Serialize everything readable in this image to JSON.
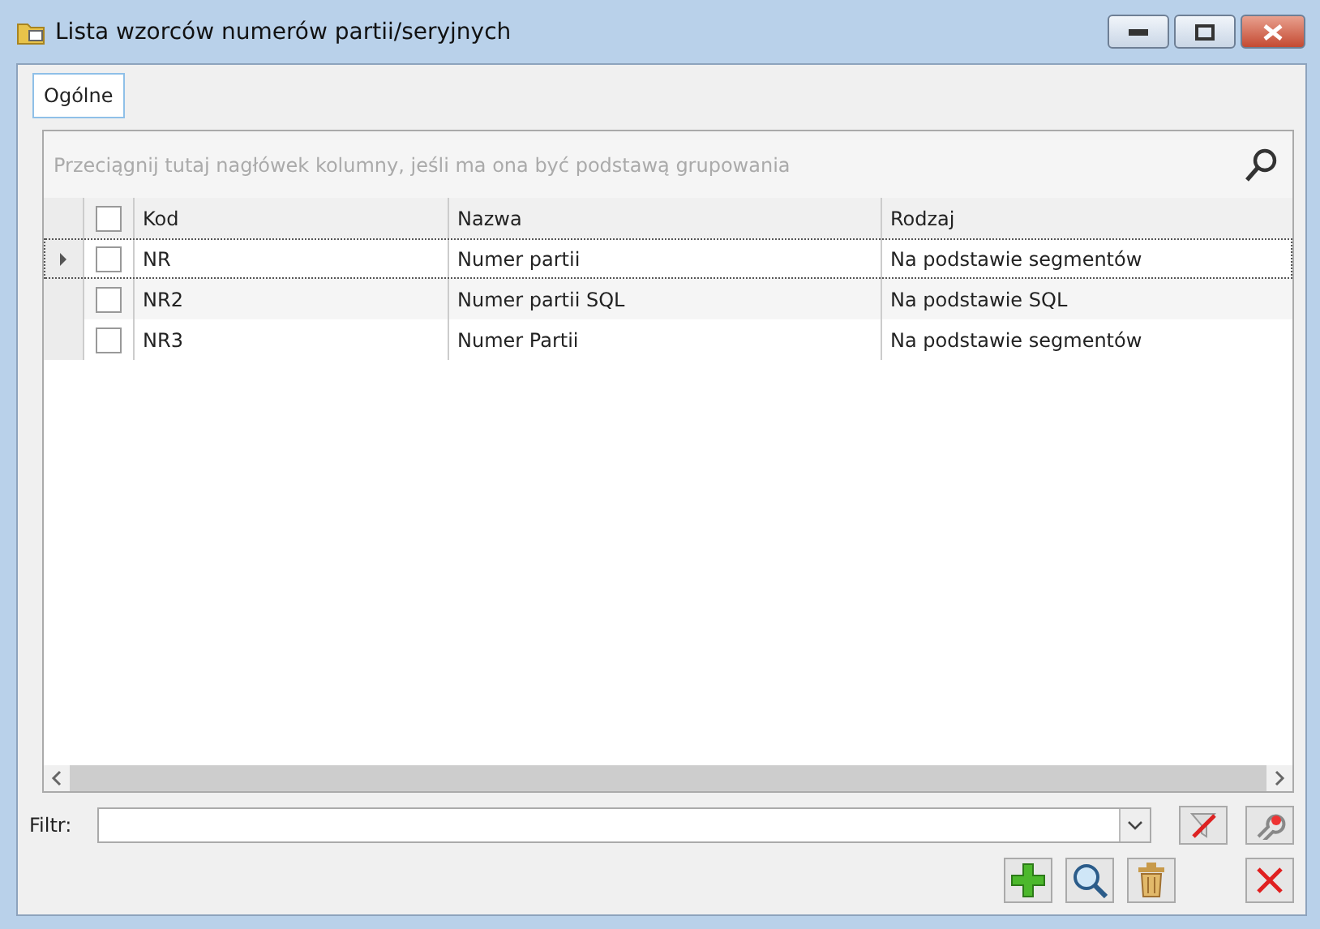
{
  "window": {
    "title": "Lista wzorców numerów partii/seryjnych"
  },
  "tabs": [
    {
      "label": "Ogólne",
      "selected": true
    }
  ],
  "group_panel": {
    "placeholder": "Przeciągnij tutaj nagłówek kolumny, jeśli ma ona być podstawą grupowania"
  },
  "table": {
    "select_all_checked": false,
    "columns": [
      "Kod",
      "Nazwa",
      "Rodzaj"
    ],
    "rows": [
      {
        "selected": true,
        "checked": false,
        "cells": [
          "NR",
          "Numer partii",
          "Na podstawie segmentów"
        ]
      },
      {
        "selected": false,
        "checked": false,
        "cells": [
          "NR2",
          "Numer partii SQL",
          "Na podstawie SQL"
        ]
      },
      {
        "selected": false,
        "checked": false,
        "cells": [
          "NR3",
          "Numer Partii",
          "Na podstawie segmentów"
        ]
      }
    ]
  },
  "filter": {
    "label": "Filtr:"
  }
}
